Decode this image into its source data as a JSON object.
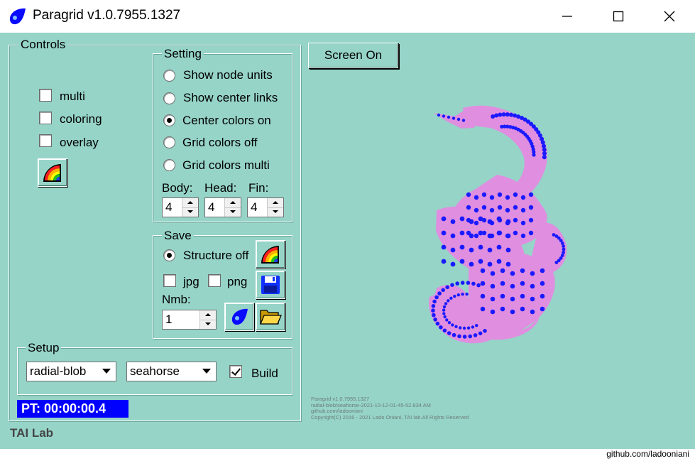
{
  "window": {
    "title": "Paragrid v1.0.7955.1327",
    "minimize_icon": "minimize-icon",
    "maximize_icon": "maximize-icon",
    "close_icon": "close-icon"
  },
  "controls": {
    "group_label": "Controls",
    "checkboxes": [
      {
        "label": "multi",
        "checked": false
      },
      {
        "label": "coloring",
        "checked": false
      },
      {
        "label": "overlay",
        "checked": false
      }
    ],
    "color_button_icon": "rainbow-icon"
  },
  "setting": {
    "group_label": "Setting",
    "radios": [
      {
        "label": "Show node units",
        "selected": false
      },
      {
        "label": "Show center links",
        "selected": false
      },
      {
        "label": "Center colors on",
        "selected": true
      },
      {
        "label": "Grid colors off",
        "selected": false
      },
      {
        "label": "Grid colors multi",
        "selected": false
      }
    ],
    "spinners": [
      {
        "label": "Body:",
        "value": "4"
      },
      {
        "label": "Head:",
        "value": "4"
      },
      {
        "label": "Fin:",
        "value": "4"
      }
    ]
  },
  "save": {
    "group_label": "Save",
    "structure_radio": {
      "label": "Structure off",
      "selected": true
    },
    "jpg": {
      "label": "jpg",
      "checked": false
    },
    "png": {
      "label": "png",
      "checked": false
    },
    "nmb_label": "Nmb:",
    "nmb_value": "1"
  },
  "setup": {
    "group_label": "Setup",
    "combo1": "radial-blob",
    "combo2": "seahorse",
    "build": {
      "label": "Build",
      "checked": true
    }
  },
  "status": {
    "pt": "PT: 00:00:00.4",
    "brand": "TAI Lab"
  },
  "canvas": {
    "screen_button": "Screen On",
    "info_lines": [
      "Paragrid v1.0.7955.1327",
      "radial-blob/seahorse-2021-10-12-01-45-52.834 AM",
      "github.com/ladooniani",
      "Copyright(C) 2016 - 2021 Lado Oniani, TAI lab.All Rights Reserved"
    ]
  },
  "footer": "github.com/ladooniani",
  "colors": {
    "background": "#96d4c8",
    "seahorse_body": "#e08ee0",
    "seahorse_dots": "#1a1aff",
    "pt_bg": "#0000ff"
  }
}
